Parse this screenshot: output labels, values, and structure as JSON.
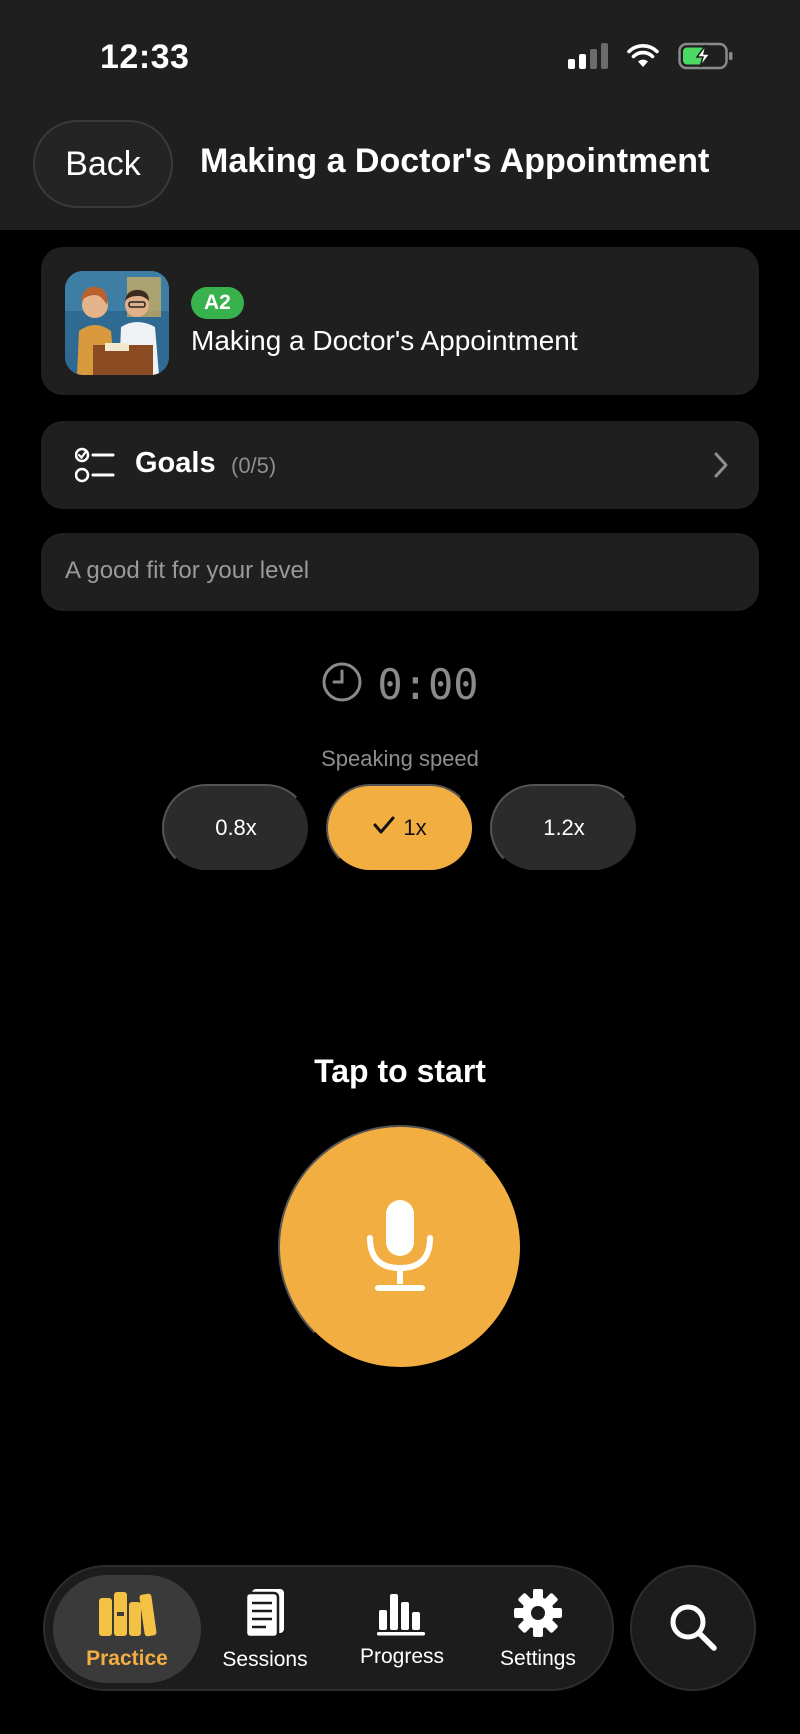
{
  "status_bar": {
    "time": "12:33"
  },
  "nav": {
    "back_label": "Back",
    "title": "Making a Doctor's Appointment"
  },
  "scenario": {
    "level": "A2",
    "title": "Making a Doctor's Appointment"
  },
  "goals": {
    "label": "Goals",
    "count": "(0/5)"
  },
  "hint": {
    "text": "A good fit for your level"
  },
  "timer": {
    "value": "0:00"
  },
  "speed": {
    "label": "Speaking speed",
    "options": [
      {
        "label": "0.8x",
        "selected": false
      },
      {
        "label": "1x",
        "selected": true
      },
      {
        "label": "1.2x",
        "selected": false
      }
    ]
  },
  "start": {
    "label": "Tap to start"
  },
  "tabs": [
    {
      "label": "Practice",
      "icon": "books-icon",
      "active": true
    },
    {
      "label": "Sessions",
      "icon": "document-icon",
      "active": false
    },
    {
      "label": "Progress",
      "icon": "bar-chart-icon",
      "active": false
    },
    {
      "label": "Settings",
      "icon": "gear-icon",
      "active": false
    }
  ],
  "colors": {
    "accent": "#f3ae42",
    "badge": "#37b24d",
    "card": "#1f1f1f"
  }
}
